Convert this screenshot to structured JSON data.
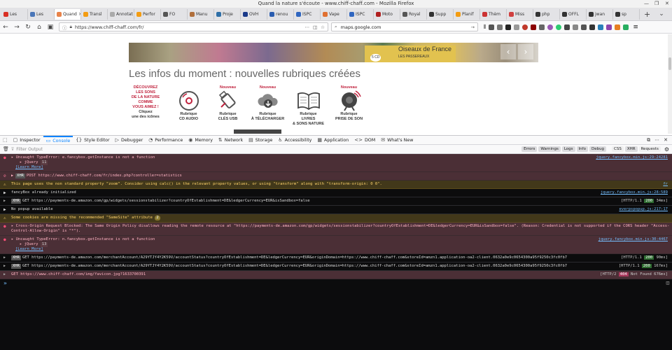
{
  "window": {
    "title": "Quand la nature s'écoute - www.chiff-chaff.com - Mozilla Firefox"
  },
  "tabs": [
    {
      "label": "Les",
      "color": "#d93025",
      "icon": "gmail-icon"
    },
    {
      "label": "Les",
      "color": "#4a76b8",
      "icon": "page-icon"
    },
    {
      "label": "Quand",
      "color": "#e8834a",
      "icon": "page-icon",
      "active": true
    },
    {
      "label": "Transl",
      "color": "#f39c12",
      "icon": "page-icon"
    },
    {
      "label": "Annotat",
      "color": "#aaaaaa",
      "icon": "page-icon"
    },
    {
      "label": "Perfor",
      "color": "#f39c12",
      "icon": "page-icon"
    },
    {
      "label": "FO",
      "color": "#555555",
      "icon": "page-icon"
    },
    {
      "label": "Manu",
      "color": "#b06f3c",
      "icon": "page-icon"
    },
    {
      "label": "Proje",
      "color": "#2f6fa7",
      "icon": "page-icon"
    },
    {
      "label": "OVH",
      "color": "#1a3a8a",
      "icon": "page-icon"
    },
    {
      "label": "renou",
      "color": "#2a5db0",
      "icon": "page-icon"
    },
    {
      "label": "ISPC",
      "color": "#3066c0",
      "icon": "page-icon"
    },
    {
      "label": "Vape",
      "color": "#e07030",
      "icon": "page-icon"
    },
    {
      "label": "ISPC",
      "color": "#3066c0",
      "icon": "page-icon"
    },
    {
      "label": "Moto",
      "color": "#b02020",
      "icon": "page-icon"
    },
    {
      "label": "Royal",
      "color": "#555555",
      "icon": "page-icon"
    },
    {
      "label": "Supp",
      "color": "#333333",
      "icon": "page-icon"
    },
    {
      "label": "Planif",
      "color": "#f39c12",
      "icon": "page-icon"
    },
    {
      "label": "Thèm",
      "color": "#cc3333",
      "icon": "page-icon"
    },
    {
      "label": "Miss",
      "color": "#d04040",
      "icon": "page-icon"
    },
    {
      "label": "php",
      "color": "#333333",
      "icon": "page-icon"
    },
    {
      "label": "OFFL",
      "color": "#333333",
      "icon": "page-icon"
    },
    {
      "label": "jwan",
      "color": "#333333",
      "icon": "page-icon"
    },
    {
      "label": "sp",
      "color": "#333333",
      "icon": "page-icon"
    }
  ],
  "nav": {
    "url": "https://www.chiff-chaff.com/fr/",
    "search_value": "maps.google.com"
  },
  "page": {
    "banner_box_top": "5 CD",
    "banner_box_title": "Oiseaux de France",
    "banner_box_sub": "LES PASSEREAUX",
    "title": "Les infos du moment : nouvelles rubriques créées",
    "promo_line1": "DÉCOUVREZ",
    "promo_line2": "LES SONS",
    "promo_line3": "DE LA NATURE",
    "promo_line4": "COMME",
    "promo_line5": "VOUS AIMEZ !",
    "promo_line6": "Cliquez",
    "promo_line7": "une des icônes",
    "rubriques": [
      {
        "new": "",
        "l1": "Rubrique",
        "l2": "CD AUDIO",
        "l3": ""
      },
      {
        "new": "Nouveau",
        "l1": "Rubrique",
        "l2": "CLÉS USB",
        "l3": ""
      },
      {
        "new": "Nouveau",
        "l1": "Rubrique",
        "l2": "À TÉLÉCHARGER",
        "l3": ""
      },
      {
        "new": "",
        "l1": "Rubrique",
        "l2": "LIVRES",
        "l3": "& SONS NATURE"
      },
      {
        "new": "Nouveau",
        "l1": "Rubrique",
        "l2": "PRISE DE SON",
        "l3": ""
      }
    ]
  },
  "devtools": {
    "tabs": [
      "Inspector",
      "Console",
      "Style Editor",
      "Debugger",
      "Performance",
      "Memory",
      "Network",
      "Storage",
      "Accessibility",
      "Application",
      "DOM",
      "What's New"
    ],
    "filter_placeholder": "Filter Output",
    "filters": [
      "Errors",
      "Warnings",
      "Logs",
      "Info",
      "Debug"
    ],
    "filters2": [
      "CSS",
      "XHR",
      "Requests"
    ]
  },
  "console": [
    {
      "type": "err",
      "text": "Uncaught TypeError: e.fancybox.getInstance is not a function",
      "src": "jquery.fancybox.min.js:29:24281",
      "sub": "jQuery",
      "count": "11",
      "more": "[Learn More]"
    },
    {
      "type": "blocked",
      "xhr": "XHR",
      "text": "POST https://www.chiff-chaff.com/fr/index.php?controller=statistics"
    },
    {
      "type": "warn",
      "text": "This page uses the non standard property \"zoom\". Consider using calc() in the relevant property values, or using \"transform\" along with \"transform-origin: 0 0\".",
      "src": "fr"
    },
    {
      "type": "info",
      "text": "fancyBox already initialized",
      "src": "jquery.fancybox.min.js:28:589"
    },
    {
      "type": "net",
      "xhr": "XHR",
      "text": "GET https://payments-de.amazon.com/gp/widgets/sessionstabilizer?countryOfEstablishment=DE&ledgerCurrency=EUR&isSandbox=false",
      "proto": "[HTTP/1.1",
      "status": "200",
      "time": "34ms]"
    },
    {
      "type": "info",
      "text": "No popup available",
      "src": "everpspopup.js:217:17"
    },
    {
      "type": "warn",
      "text": "Some cookies are missing the recommended \"SameSite\" attribute",
      "badge": "2"
    },
    {
      "type": "err",
      "text": "Cross-Origin Request Blocked: The Same Origin Policy disallows reading the remote resource at \"https://payments-de.amazon.com/gp/widgets/sessionstabilizer?countryOfEstablishment=DE&ledgerCurrency=EUR&isSandbox=false\". (Reason: Credential is not supported if the CORS header \"Access-",
      "text2": "Control-Allow-Origin\" is \"*\").",
      "more": "[Learn More]"
    },
    {
      "type": "err",
      "text": "Uncaught TypeError: n.fancybox.getInstance is not a function",
      "src": "jquery.fancybox.min.js:30:4467",
      "sub": "jQuery",
      "count": "13",
      "more": "[Learn More]"
    },
    {
      "type": "net",
      "xhr": "XHR",
      "text": "GET https://payments-de.amazon.com/merchantAccount/A29YTJY4Y2K59V/accountStatus?countryOfEstablishment=DE&ledgerCurrency=EUR&originDomain=https://www.chiff-chaff.com&storeId=amzn1.application-oa2-client.0632a0e9c0654300a95f9250c3fc0fb7",
      "proto": "[HTTP/1.1",
      "status": "200",
      "time": "90ms]"
    },
    {
      "type": "net",
      "xhr": "XHR",
      "text": "GET https://payments-de.amazon.com/merchantAccount/A29YTJY4Y2K59V/accountStatus?countryOfEstablishment=DE&ledgerCurrency=EUR&originDomain=https://www.chiff-chaff.com&storeId=amzn1.application-oa2-client.0632a0e9c0654300a95f9250c3fc0fb7",
      "proto": "[HTTP/1.1",
      "status": "200",
      "time": "167ms]"
    },
    {
      "type": "errnet",
      "text": "GET https://www.chiff-chaff.com/img/favicon.jpg?1633700391",
      "proto": "[HTTP/2",
      "status": "404",
      "time": "Not Found 676ms]"
    }
  ],
  "prompt": "»"
}
